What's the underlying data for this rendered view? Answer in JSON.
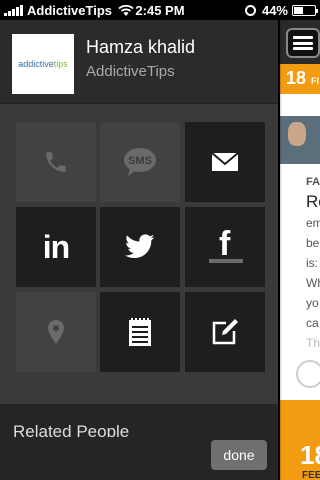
{
  "status_bar": {
    "carrier": "AddictiveTips",
    "time": "2:45 PM",
    "battery": "44%",
    "battery_level": 0.44
  },
  "profile": {
    "name": "Hamza khalid",
    "organization": "AddictiveTips",
    "avatar_logo": {
      "prefix": "addictive",
      "suffix": "tips"
    }
  },
  "actions": [
    {
      "name": "phone-icon",
      "enabled": false
    },
    {
      "name": "sms-icon",
      "label": "SMS",
      "enabled": false
    },
    {
      "name": "email-icon",
      "enabled": true
    },
    {
      "name": "linkedin-icon",
      "label": "in",
      "enabled": true
    },
    {
      "name": "twitter-icon",
      "enabled": true
    },
    {
      "name": "facebook-icon",
      "label": "f",
      "enabled": true
    },
    {
      "name": "location-icon",
      "enabled": false
    },
    {
      "name": "notes-icon",
      "enabled": true
    },
    {
      "name": "compose-icon",
      "enabled": true
    }
  ],
  "related": {
    "title": "Related People"
  },
  "done_label": "done",
  "background_app": {
    "header_number": "18",
    "header_suffix": "FI",
    "category": "FA",
    "title_fragment": "Re",
    "body_lines": [
      "em",
      "be",
      "is:",
      "Wh",
      "yo",
      "ca",
      "Th"
    ],
    "footer_number": "18",
    "footer_label": "FEE"
  },
  "colors": {
    "accent": "#f39c12",
    "panel": "#2b2b2b",
    "tile_active": "#1e1e1e",
    "tile_dim": "#424242"
  }
}
